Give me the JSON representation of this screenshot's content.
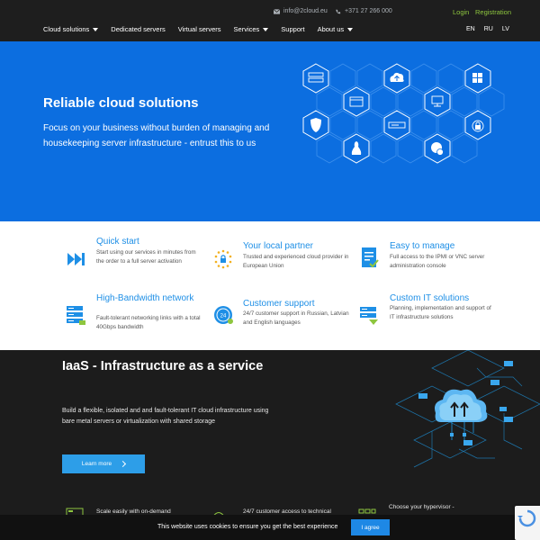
{
  "topbar": {
    "email": "info@2cloud.eu",
    "phone": "+371 27 266 000",
    "login_label": "Login",
    "register_label": "Registration"
  },
  "nav": {
    "items": [
      {
        "label": "Cloud solutions",
        "dropdown": true
      },
      {
        "label": "Dedicated servers",
        "dropdown": false
      },
      {
        "label": "Virtual servers",
        "dropdown": false
      },
      {
        "label": "Services",
        "dropdown": true
      },
      {
        "label": "Support",
        "dropdown": false
      },
      {
        "label": "About us",
        "dropdown": true
      }
    ],
    "languages": [
      "EN",
      "RU",
      "LV"
    ]
  },
  "hero": {
    "title": "Reliable cloud solutions",
    "text": "Focus on your business without burden of managing and housekeeping server infrastructure - entrust this to us",
    "icons": [
      "server-icon",
      "cloud-upload-icon",
      "windows-icon",
      "browser-icon",
      "monitor-icon",
      "shield-icon",
      "drive-icon",
      "lock-icon",
      "linux-icon",
      "chat-icon"
    ]
  },
  "features": [
    {
      "title": "Quick start",
      "desc": "Start using our services in minutes from the order to a full server activation",
      "icon": "fast-forward-icon"
    },
    {
      "title": "Your local partner",
      "desc": "Trusted and experienced cloud provider in European Union",
      "icon": "eu-lock-icon"
    },
    {
      "title": "Easy to manage",
      "desc": "Full access to the IPMI or VNC server administration console",
      "icon": "document-check-icon"
    },
    {
      "title": "High-Bandwidth network",
      "desc": "Fault-tolerant networking links with a total 40Gbps bandwidth",
      "icon": "server-rack-icon"
    },
    {
      "title": "Customer support",
      "desc": "24/7 customer support in Russian, Latvian and English languages",
      "icon": "support-24-icon"
    },
    {
      "title": "Custom IT solutions",
      "desc": "Planning, implementation and support of IT infrastructure solutions",
      "icon": "server-settings-icon"
    }
  ],
  "iaas": {
    "title": "IaaS - Infrastructure as a service",
    "text": "Build a flexible, isolated and and fault-tolerant IT cloud infrastructure using bare metal servers or virtualization with shared storage",
    "button_label": "Learn more",
    "bottom_features": [
      "Scale easily with on-demand",
      "24/7 customer access to technical",
      "Choose your hypervisor -"
    ]
  },
  "cookie": {
    "text": "This website uses cookies to ensure you get the best experience",
    "button_label": "I agree"
  },
  "colors": {
    "hero_blue": "#0c6ee0",
    "accent_green": "#8ec63f",
    "feature_blue": "#1e8fe6",
    "button_blue": "#2d9ee8"
  }
}
